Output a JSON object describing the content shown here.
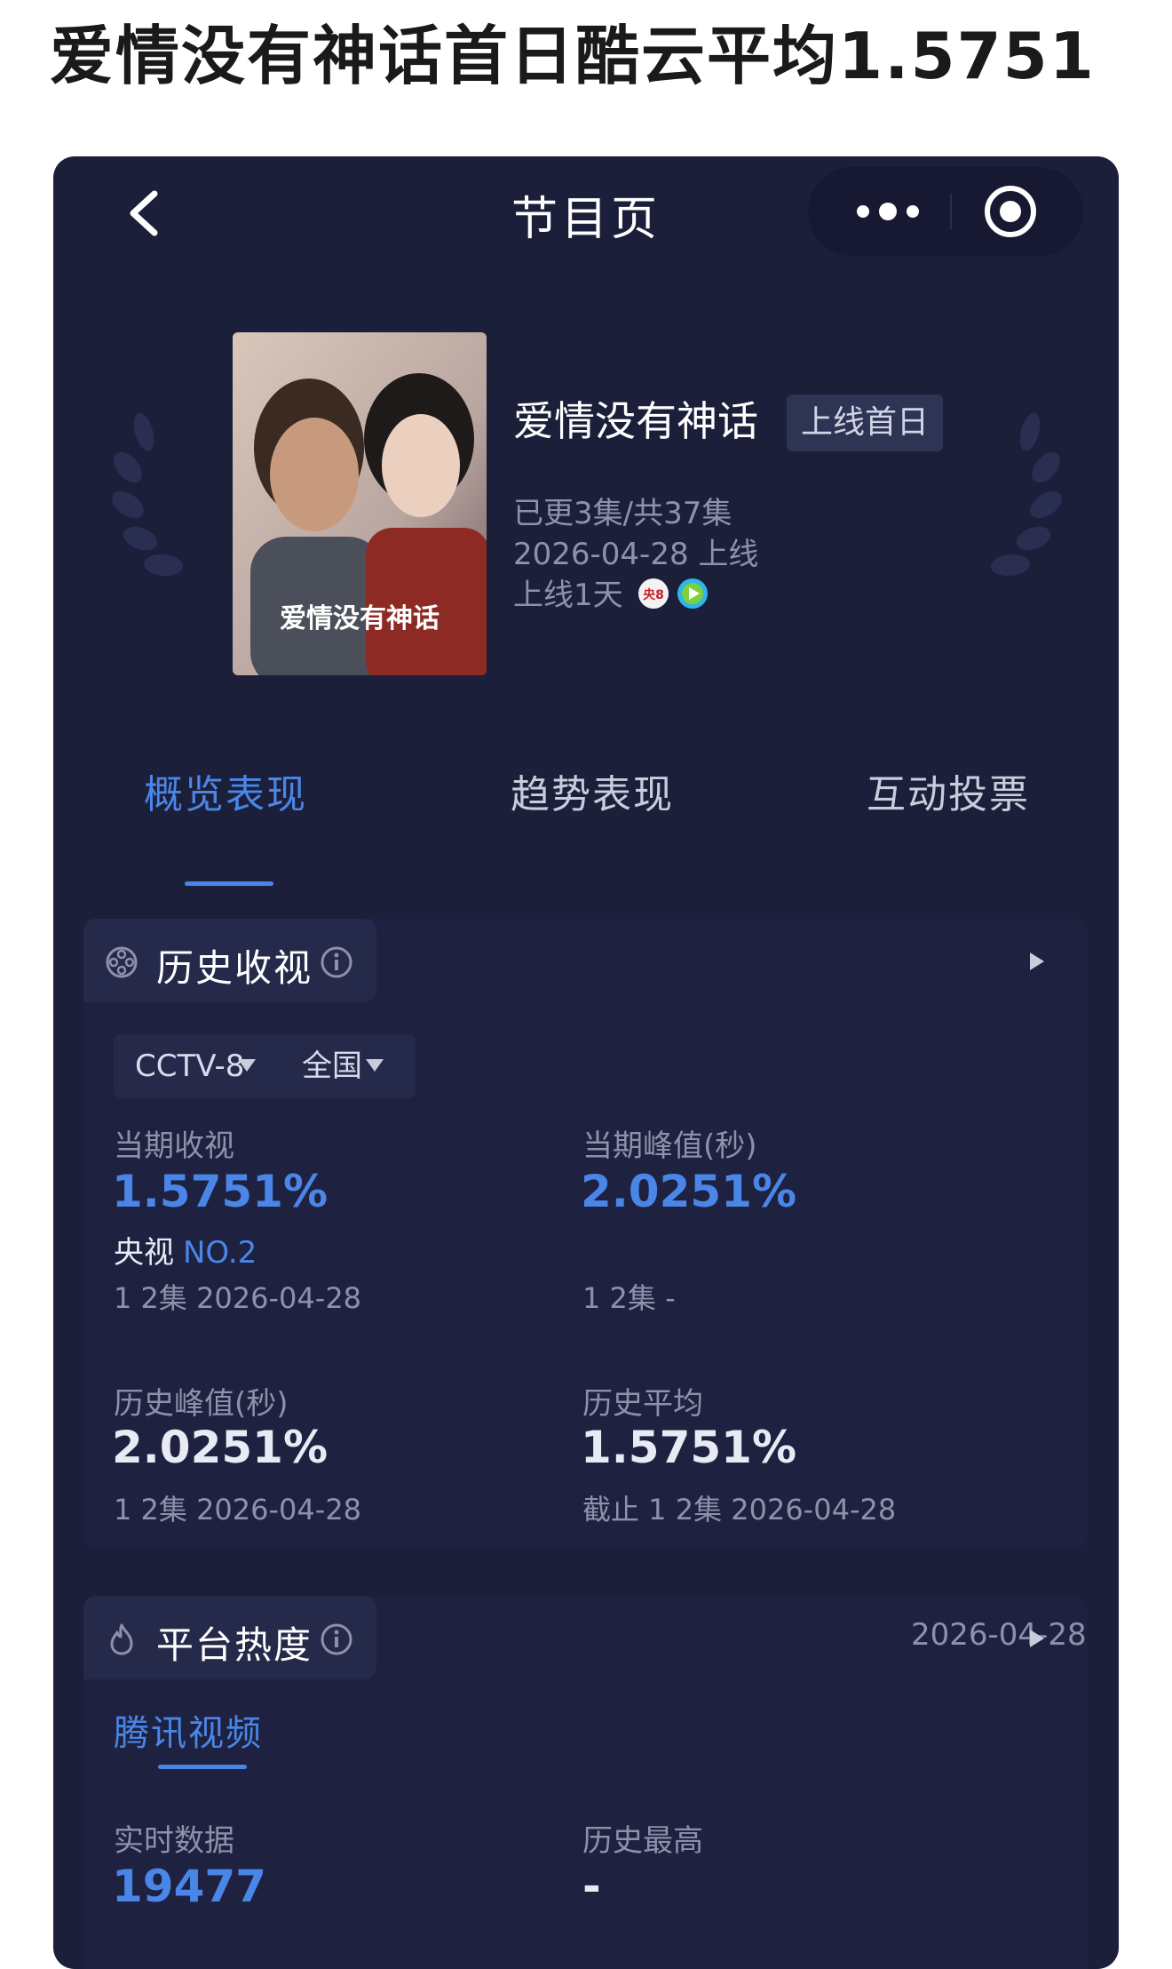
{
  "headline": "爱情没有神话首日酷云平均1.5751",
  "navbar": {
    "title": "节目页",
    "back_icon": "chevron-left-icon",
    "more_icon": "more-dots-icon",
    "close_icon": "target-icon"
  },
  "show": {
    "poster_caption": "爱情没有神话",
    "title": "爱情没有神话",
    "badge": "上线首日",
    "episodes": "已更3集/共37集",
    "release": "2026-04-28 上线",
    "online_days": "上线1天",
    "channel_logo_text": "央8"
  },
  "tabs": [
    "概览表现",
    "趋势表现",
    "互动投票"
  ],
  "history": {
    "title": "历史收视",
    "channel": "CCTV-8",
    "region": "全国",
    "current_rating_label": "当期收视",
    "current_rating_value": "1.5751%",
    "rank_prefix": "央视",
    "rank_value": "NO.2",
    "current_rating_sub": "1 2集 2026-04-28",
    "current_peak_label": "当期峰值(秒)",
    "current_peak_value": "2.0251%",
    "current_peak_sub": "1 2集 -",
    "history_peak_label": "历史峰值(秒)",
    "history_peak_value": "2.0251%",
    "history_peak_sub": "1 2集 2026-04-28",
    "history_avg_label": "历史平均",
    "history_avg_value": "1.5751%",
    "history_avg_sub": "截止 1 2集 2026-04-28"
  },
  "heat": {
    "title": "平台热度",
    "date": "2026-04-28",
    "platform": "腾讯视频",
    "realtime_label": "实时数据",
    "realtime_value": "19477",
    "history_high_label": "历史最高",
    "history_high_value": "-"
  },
  "colors": {
    "background": "#1c1f3a",
    "accent": "#4a86e8",
    "muted": "#8d92ab"
  }
}
